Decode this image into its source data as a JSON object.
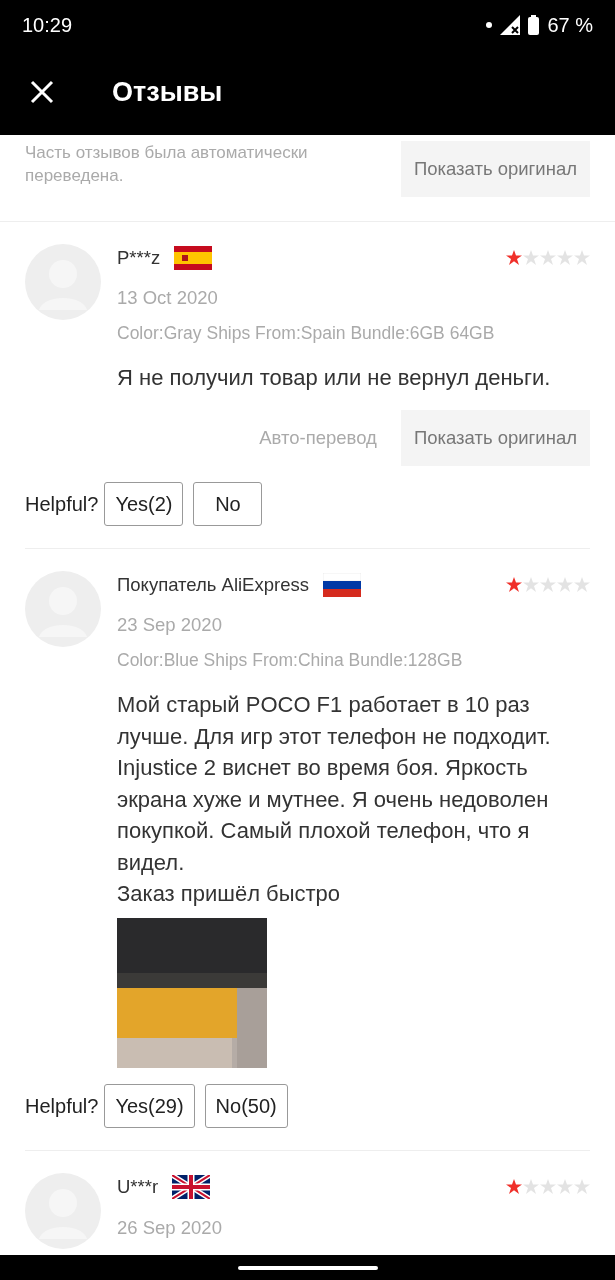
{
  "status_bar": {
    "time": "10:29",
    "battery": "67 %"
  },
  "app_bar": {
    "title": "Отзывы"
  },
  "notice": {
    "text": "Часть отзывов была автоматически переведена.",
    "button": "Показать оригинал"
  },
  "reviews": [
    {
      "author": "P***z",
      "flag": {
        "kind": "es"
      },
      "stars": 1,
      "date": "13 Oct 2020",
      "meta": "Color:Gray Ships From:Spain Bundle:6GB 64GB",
      "paragraphs": [
        "Я не получил товар или не вернул деньги."
      ],
      "translation": {
        "label": "Авто-перевод",
        "button": "Показать оригинал"
      },
      "helpful": {
        "label": "Helpful?",
        "yes": "Yes(2)",
        "no": "No"
      }
    },
    {
      "author": "Покупатель AliExpress",
      "flag": {
        "kind": "ru"
      },
      "stars": 1,
      "date": "23 Sep 2020",
      "meta": "Color:Blue Ships From:China Bundle:128GB",
      "paragraphs": [
        "Мой старый POCO F1 работает в 10 раз лучше. Для игр этот телефон не подходит. Injustice 2 виснет во время боя. Яркость экрана хуже и мутнее. Я очень недоволен покупкой. Самый плохой телефон, что я видел.",
        "Заказ пришёл быстро"
      ],
      "photos": [
        {
          "kind": "picture"
        }
      ],
      "helpful": {
        "label": "Helpful?",
        "yes": "Yes(29)",
        "no": "No(50)"
      }
    },
    {
      "author": "U***r",
      "flag": {
        "kind": "gb"
      },
      "stars": 1,
      "date": "26 Sep 2020"
    }
  ]
}
